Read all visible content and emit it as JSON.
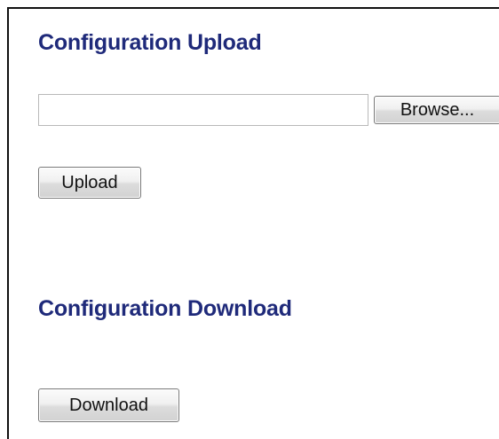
{
  "upload": {
    "title": "Configuration Upload",
    "file_input": {
      "value": "",
      "placeholder": ""
    },
    "browse_label": "Browse...",
    "upload_label": "Upload"
  },
  "download": {
    "title": "Configuration Download",
    "download_label": "Download"
  },
  "colors": {
    "heading": "#1f2a7a",
    "frame_border": "#111111"
  }
}
